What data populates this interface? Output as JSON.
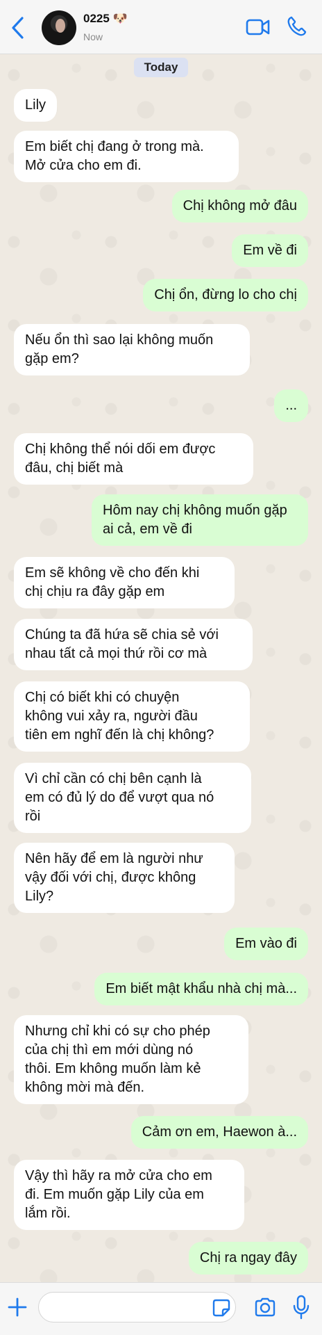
{
  "header": {
    "contact_name": "0225 🐶",
    "status": "Now",
    "back_icon": "chevron-left-icon",
    "video_icon": "video-camera-icon",
    "call_icon": "phone-icon"
  },
  "chat": {
    "date_label": "Today",
    "messages": [
      {
        "direction": "in",
        "text": "Lily"
      },
      {
        "direction": "in",
        "text": "Em biết chị đang ở trong mà.\nMở cửa cho em đi."
      },
      {
        "direction": "out",
        "text": "Chị không mở đâu"
      },
      {
        "direction": "out",
        "text": "Em về đi"
      },
      {
        "direction": "out",
        "text": "Chị ổn, đừng lo cho chị"
      },
      {
        "direction": "in",
        "text": "Nếu ổn thì sao lại không muốn\ngặp em?"
      },
      {
        "direction": "out",
        "text": "..."
      },
      {
        "direction": "in",
        "text": "Chị không thể nói dối em được\nđâu, chị biết mà"
      },
      {
        "direction": "out",
        "text": "Hôm nay chị không muốn gặp\nai cả, em về đi"
      },
      {
        "direction": "in",
        "text": "Em sẽ không về cho đến khi\nchị chịu ra đây gặp em"
      },
      {
        "direction": "in",
        "text": "Chúng ta đã hứa sẽ chia sẻ với\nnhau tất cả mọi thứ rồi cơ mà"
      },
      {
        "direction": "in",
        "text": "Chị có biết khi có chuyện\nkhông vui xảy ra, người đầu\ntiên em nghĩ đến là chị không?"
      },
      {
        "direction": "in",
        "text": "Vì chỉ cần có chị bên cạnh là\nem có đủ lý do để vượt qua nó\nrồi"
      },
      {
        "direction": "in",
        "text": "Nên hãy để em là người như\nvậy đối với chị, được không\nLily?"
      },
      {
        "direction": "out",
        "text": "Em vào đi"
      },
      {
        "direction": "out",
        "text": "Em biết mật khẩu nhà chị mà..."
      },
      {
        "direction": "in",
        "text": "Nhưng chỉ khi có sự cho phép\ncủa chị thì em mới dùng nó\nthôi. Em không muốn làm kẻ\nkhông mời mà đến."
      },
      {
        "direction": "out",
        "text": "Cảm ơn em, Haewon à..."
      },
      {
        "direction": "in",
        "text": "Vậy thì hãy ra mở cửa cho em\nđi. Em muốn gặp Lily của em\nlắm rồi."
      },
      {
        "direction": "out",
        "text": "Chị ra ngay đây"
      }
    ]
  },
  "composer": {
    "input_value": "",
    "plus_icon": "plus-icon",
    "sticker_icon": "sticker-icon",
    "camera_icon": "camera-icon",
    "mic_icon": "microphone-icon"
  },
  "colors": {
    "accent": "#1f7aec",
    "incoming_bubble": "#ffffff",
    "outgoing_bubble": "#d9fdd3",
    "chat_background": "#efeae2"
  }
}
